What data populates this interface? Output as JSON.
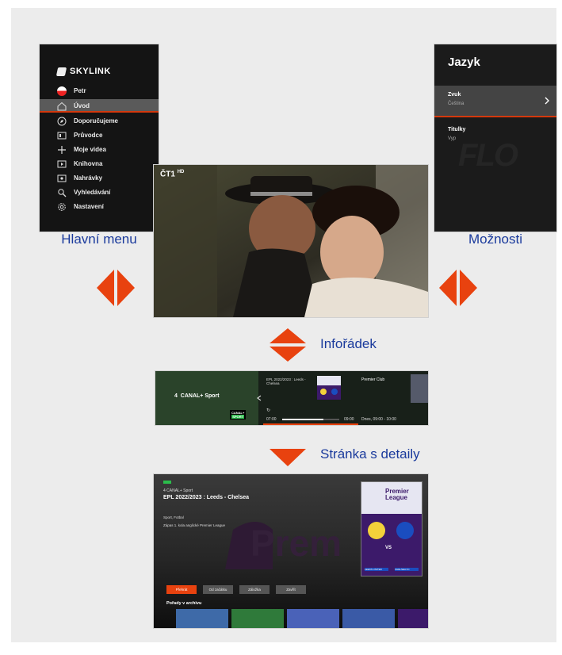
{
  "main_menu": {
    "brand": "SKYLINK",
    "items": [
      {
        "label": "Petr",
        "icon": "avatar-icon",
        "active": false
      },
      {
        "label": "Úvod",
        "icon": "home-icon",
        "active": true
      },
      {
        "label": "Doporučujeme",
        "icon": "compass-icon",
        "active": false
      },
      {
        "label": "Průvodce",
        "icon": "guide-icon",
        "active": false
      },
      {
        "label": "Moje videa",
        "icon": "plus-icon",
        "active": false
      },
      {
        "label": "Knihovna",
        "icon": "library-icon",
        "active": false
      },
      {
        "label": "Nahrávky",
        "icon": "recordings-icon",
        "active": false
      },
      {
        "label": "Vyhledávání",
        "icon": "search-icon",
        "active": false
      },
      {
        "label": "Nastavení",
        "icon": "gear-icon",
        "active": false
      }
    ],
    "caption": "Hlavní menu"
  },
  "options": {
    "title": "Jazyk",
    "audio_label": "Zvuk",
    "audio_value": "Čeština",
    "subtitles_label": "Titulky",
    "subtitles_value": "Vyp",
    "background_text": "FLO",
    "caption": "Možnosti"
  },
  "video": {
    "channel_logo": "ČT1",
    "hd_badge": "HD"
  },
  "info_row": {
    "caption": "Infořádek",
    "channel_number": "4",
    "channel_name": "CANAL+ Sport",
    "program_title": "EPL 2022/2023 : Leeds - Chelsea",
    "time_start": "07:00",
    "time_end": "09:00",
    "next_program": "Premier Club",
    "next_time": "Dnes, 09:00 - 10:00",
    "channel_logo_text": "CANAL+",
    "channel_logo_sub": "SPORT",
    "progress": 0.72
  },
  "detail_page": {
    "caption": "Stránka s detaily",
    "breadcrumb": "4 CANAL+ Sport",
    "title": "EPL 2022/2023 : Leeds - Chelsea",
    "genre": "Sport, Fotbal",
    "description": "Zápas 1. kola anglické Premier League",
    "background_text": "Prem",
    "buttons": [
      "Přehrát",
      "Od začátku",
      "Záložka",
      "Zavřít"
    ],
    "section_title": "Pořady v archivu",
    "poster_title": "Premier League",
    "poster_vs": "VS",
    "poster_left_team": "LEEDS UNITED",
    "poster_right_team": "CHELSEA FC"
  },
  "colors": {
    "accent": "#e8420f",
    "caption": "#1a3a9c",
    "panel_bg": "#ececec"
  }
}
